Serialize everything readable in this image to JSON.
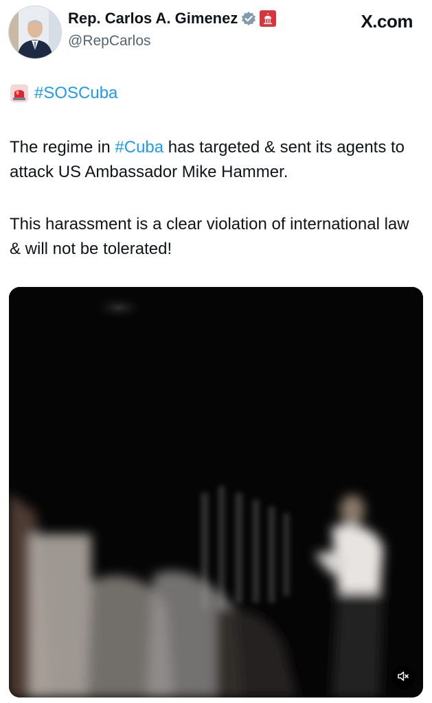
{
  "header": {
    "display_name": "Rep. Carlos A. Gimenez",
    "handle": "@RepCarlos",
    "brand": "X.com"
  },
  "tweet": {
    "hashtag": "#SOSCuba",
    "paragraph1": {
      "before": "The regime in ",
      "link": "#Cuba",
      "after": " has targeted & sent its agents to attack US Ambassador Mike Hammer."
    },
    "paragraph2": "This harassment is a clear violation of international law & will not be tolerated!"
  },
  "icons": {
    "verified": "verified-badge-icon",
    "government": "capitol-icon",
    "siren": "rotating-light-icon",
    "mute": "muted-speaker-icon"
  },
  "colors": {
    "link": "#1d9bf0",
    "text": "#0f1419",
    "secondary": "#536471"
  }
}
